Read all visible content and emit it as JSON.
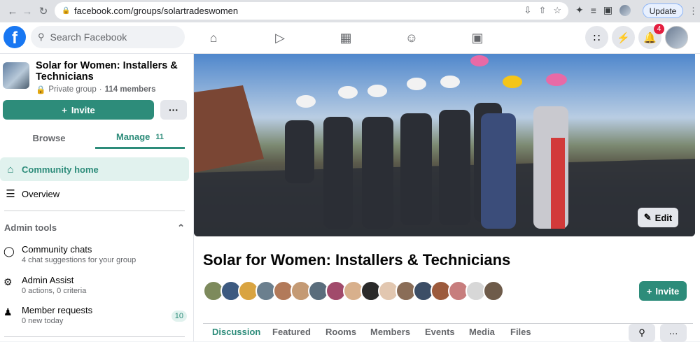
{
  "browser": {
    "url": "facebook.com/groups/solartradeswomen",
    "update_label": "Update"
  },
  "header": {
    "search_placeholder": "Search Facebook",
    "notification_count": "4"
  },
  "sidebar": {
    "group_name": "Solar for Women: Installers & Technicians",
    "privacy": "Private group",
    "members": "114 members",
    "invite_label": "Invite",
    "more_label": "···",
    "tabs": [
      {
        "label": "Browse",
        "count": ""
      },
      {
        "label": "Manage",
        "count": "11"
      }
    ],
    "items": [
      {
        "label": "Community home",
        "icon": "home-icon"
      },
      {
        "label": "Overview",
        "icon": "layers-icon"
      }
    ],
    "admin_tools_label": "Admin tools",
    "tools": [
      {
        "title": "Community chats",
        "subtitle": "4 chat suggestions for your group",
        "icon": "chat-icon",
        "count": ""
      },
      {
        "title": "Admin Assist",
        "subtitle": "0 actions, 0 criteria",
        "icon": "gear-icon",
        "count": ""
      },
      {
        "title": "Member requests",
        "subtitle": "0 new today",
        "icon": "add-person-icon",
        "count": "10"
      }
    ]
  },
  "main": {
    "edit_label": "Edit",
    "group_title": "Solar for Women: Installers & Technicians",
    "invite_label": "Invite",
    "tabs": [
      "Discussion",
      "Featured",
      "Rooms",
      "Members",
      "Events",
      "Media",
      "Files"
    ],
    "more_label": "···"
  },
  "colors": {
    "accent": "#2d8c7a",
    "facebook_blue": "#1877f2"
  }
}
